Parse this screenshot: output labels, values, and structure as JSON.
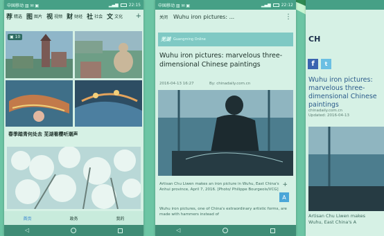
{
  "phone1": {
    "status_left": "中国移动 ▥ ✉ ▣",
    "status_right": "22:15",
    "nav_tabs": [
      "荐",
      "图",
      "视",
      "财",
      "社",
      "文"
    ],
    "nav_tab_small": [
      "精选",
      "图片",
      "视频",
      "财经",
      "社会",
      "文化"
    ],
    "plus": "+",
    "album_count": "10",
    "caption": "春季踏青何处去 芜湖看樱听潮声",
    "bottom_tabs": [
      "首页",
      "政务",
      "我的"
    ]
  },
  "phone2": {
    "status_left": "中国移动 ▥ ✉ ▣",
    "status_right": "22:12",
    "close": "关闭",
    "title": "Wuhu iron pictures: ...",
    "menu": "⋮",
    "logo": "芜湖",
    "channel": "Guangming Online",
    "headline": "Wuhu iron pictures: marvelous three-dimensional Chinese paintings",
    "date": "2016-04-13 16:27",
    "source": "By: chinadaily.com.cn",
    "photo_caption": "Artisan Chu Liwen makes an iron picture in Wuhu, East China's Anhui province, April 7, 2016. [Photo/ Philippe Bourgeois/VCG]",
    "body": "Wuhu iron pictures, one of China's extraordinary artistic forms, are made with hammers instead of",
    "plus": "+",
    "a_button": "A"
  },
  "phone3": {
    "logo": "CH",
    "fb": "f",
    "tw": "t",
    "headline": "Wuhu iron pictures: marvelous three-dimensional Chinese paintings",
    "meta1": "chinadaily.com.cn",
    "meta2": "Updated: 2016-04-13",
    "caption1": "Artisan Chu Liwen makes",
    "caption2": "Wuhu, East China's A"
  },
  "colors": {
    "background": "#6cc5a4",
    "arc_dark": "#2f8a53",
    "arc_light": "#c8f5d2",
    "active_tab": "#2f7fd0"
  }
}
